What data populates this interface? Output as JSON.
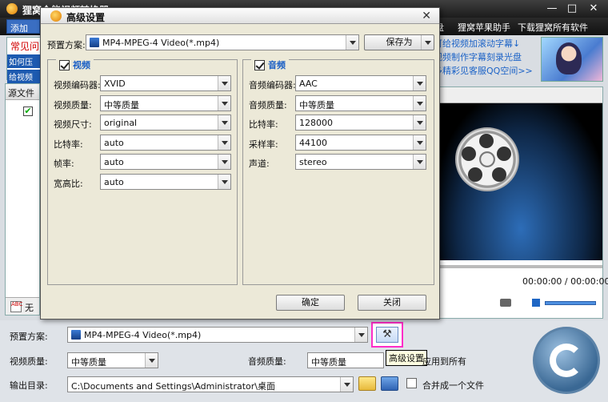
{
  "main": {
    "title": "狸窝全能视频转换器",
    "menu": [
      "盘",
      "狸窝苹果助手",
      "下载狸窝所有软件"
    ],
    "add_button": "添加",
    "faq_title": "常见问",
    "faq_links": [
      "如何压",
      "给视频"
    ],
    "promo_links": [
      "可给视频加滚动字幕↓",
      "视频制作字幕刻录光盘",
      "多精彩见客服QQ空间>>"
    ],
    "source_header": "源文件",
    "subtitle_label": "无",
    "time": "00:00:00 / 00:00:00"
  },
  "bottom": {
    "preset_label": "预置方案:",
    "preset_value": "MP4-MPEG-4 Video(*.mp4)",
    "video_quality_label": "视频质量:",
    "video_quality_value": "中等质量",
    "audio_quality_label": "音频质量:",
    "audio_quality_value": "中等质量",
    "apply_all": "应用到所有",
    "output_label": "输出目录:",
    "output_value": "C:\\Documents and Settings\\Administrator\\桌面",
    "merge_label": "合并成一个文件",
    "tooltip": "高级设置"
  },
  "dialog": {
    "title": "高级设置",
    "preset_label": "预置方案:",
    "preset_value": "MP4-MPEG-4 Video(*.mp4)",
    "save_as": "保存为",
    "video_group": "视频",
    "audio_group": "音频",
    "video_fields": [
      {
        "label": "视频编码器:",
        "value": "XVID"
      },
      {
        "label": "视频质量:",
        "value": "中等质量"
      },
      {
        "label": "视频尺寸:",
        "value": "original"
      },
      {
        "label": "比特率:",
        "value": "auto"
      },
      {
        "label": "帧率:",
        "value": "auto"
      },
      {
        "label": "宽高比:",
        "value": "auto"
      }
    ],
    "audio_fields": [
      {
        "label": "音频编码器:",
        "value": "AAC"
      },
      {
        "label": "音频质量:",
        "value": "中等质量"
      },
      {
        "label": "比特率:",
        "value": "128000"
      },
      {
        "label": "采样率:",
        "value": "44100"
      },
      {
        "label": "声道:",
        "value": "stereo"
      }
    ],
    "ok": "确定",
    "close": "关闭"
  },
  "colors": {
    "accent": "#1a5fc5",
    "highlight_border": "#ff2ec8"
  }
}
